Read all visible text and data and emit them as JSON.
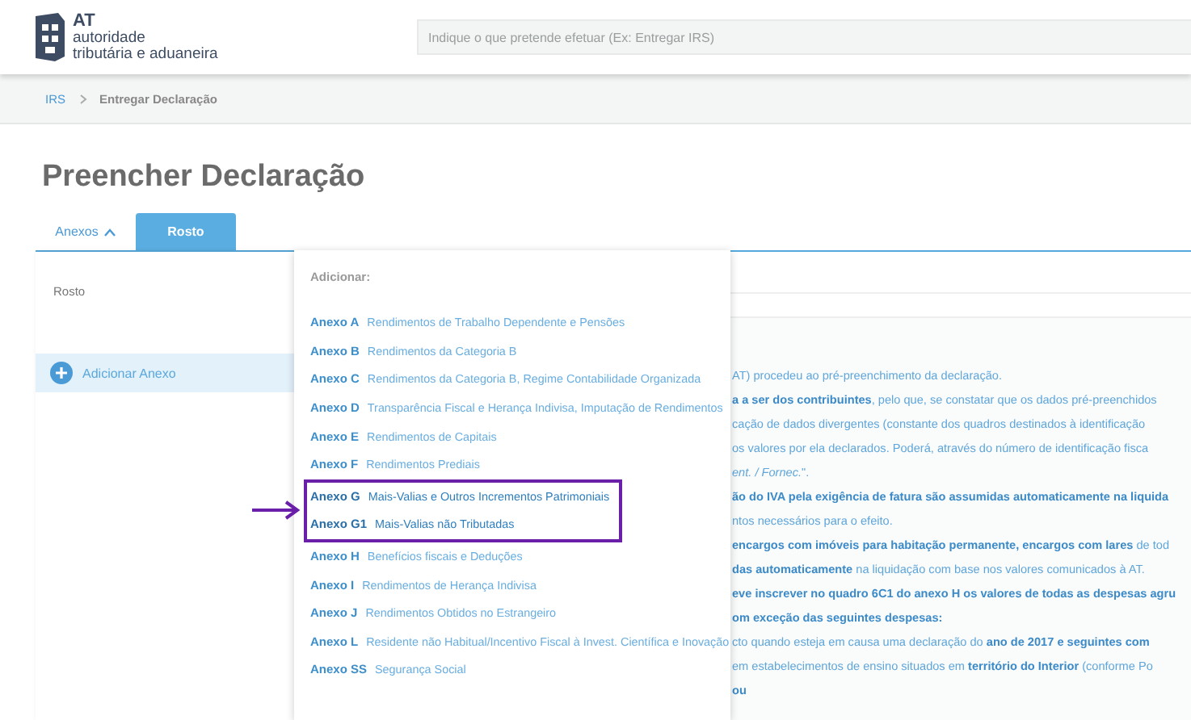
{
  "header": {
    "logo": {
      "title": "AT",
      "line1": "autoridade",
      "line2": "tributária e aduaneira"
    },
    "search": {
      "placeholder": "Indique o que pretende efetuar (Ex: Entregar IRS)"
    }
  },
  "breadcrumb": [
    {
      "label": "IRS",
      "link": true
    },
    {
      "label": "Entregar Declaração",
      "link": false
    }
  ],
  "page_title": "Preencher Declaração",
  "tabs": [
    {
      "label": "Anexos",
      "selected": false,
      "expanded": true
    },
    {
      "label": "Rosto",
      "selected": true,
      "expanded": false
    }
  ],
  "sidebar": {
    "items": [
      {
        "label": "Rosto",
        "kind": "text"
      },
      {
        "label": "Adicionar Anexo",
        "kind": "add"
      }
    ]
  },
  "content_lines": [
    {
      "text": "AT) procedeu ao pré-preenchimento da declaração."
    },
    {
      "text": "**a a ser dos contribuintes**, pelo que, se constatar que os dados pré-preenchidos"
    },
    {
      "text": "cação de dados divergentes (constante dos quadros destinados à identificação"
    },
    {
      "text": "os valores por ela declarados. Poderá, através do número de identificação fisca"
    },
    {
      "text": "*ent. / Fornec.*\"."
    },
    {
      "text": "**ão do IVA pela exigência de fatura são assumidas automaticamente na liquida**"
    },
    {
      "text": "ntos necessários para o efeito."
    },
    {
      "text": "**encargos com imóveis para habitação permanente, encargos com lares** de tod"
    },
    {
      "text": "**das automaticamente** na liquidação com base nos valores comunicados à AT."
    },
    {
      "text": "**eve inscrever no quadro 6C1 do anexo H os valores de todas as despesas agru**"
    },
    {
      "text": "**om exceção das seguintes despesas:**"
    },
    {
      "text": "cto quando esteja em causa uma declaração do **ano de 2017 e seguintes com**"
    },
    {
      "text": "em estabelecimentos de ensino situados em **território do Interior** (conforme Po"
    },
    {
      "text": "**ou**"
    }
  ],
  "dropdown": {
    "heading": "Adicionar:",
    "items": [
      {
        "code": "Anexo A",
        "label": "Rendimentos de Trabalho Dependente e Pensões",
        "highlighted": false
      },
      {
        "code": "Anexo B",
        "label": "Rendimentos da Categoria B",
        "highlighted": false
      },
      {
        "code": "Anexo C",
        "label": "Rendimentos da Categoria B, Regime Contabilidade Organizada",
        "highlighted": false
      },
      {
        "code": "Anexo D",
        "label": "Transparência Fiscal e Herança Indivisa, Imputação de Rendimentos",
        "highlighted": false
      },
      {
        "code": "Anexo E",
        "label": "Rendimentos de Capitais",
        "highlighted": false
      },
      {
        "code": "Anexo F",
        "label": "Rendimentos Prediais",
        "highlighted": false
      },
      {
        "code": "Anexo G",
        "label": "Mais-Valias e Outros Incrementos Patrimoniais",
        "highlighted": true
      },
      {
        "code": "Anexo G1",
        "label": "Mais-Valias não Tributadas",
        "highlighted": true
      },
      {
        "code": "Anexo H",
        "label": "Benefícios fiscais e Deduções",
        "highlighted": false
      },
      {
        "code": "Anexo I",
        "label": "Rendimentos de Herança Indivisa",
        "highlighted": false
      },
      {
        "code": "Anexo J",
        "label": "Rendimentos Obtidos no Estrangeiro",
        "highlighted": false
      },
      {
        "code": "Anexo L",
        "label": "Residente não Habitual/Incentivo Fiscal à Invest. Científica e Inovação",
        "highlighted": false
      },
      {
        "code": "Anexo SS",
        "label": "Segurança Social",
        "highlighted": false
      }
    ]
  }
}
